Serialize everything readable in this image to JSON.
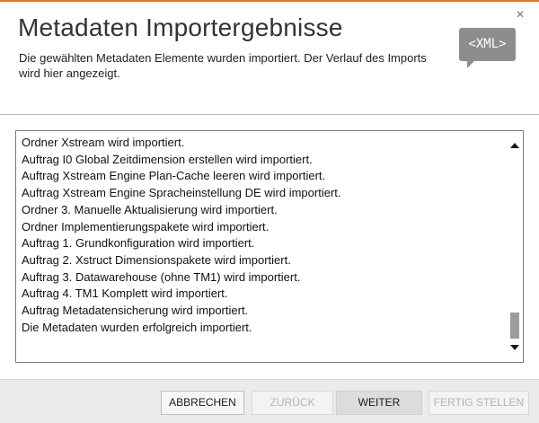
{
  "header": {
    "title": "Metadaten Importergebnisse",
    "description": "Die gewählten Metadaten Elemente wurden importiert. Der Verlauf des Imports wird hier angezeigt.",
    "icon_label": "<XML>"
  },
  "close": {
    "glyph": "×"
  },
  "log": {
    "lines": [
      "Ordner Xstream wird importiert.",
      "Auftrag I0 Global Zeitdimension erstellen wird importiert.",
      "Auftrag Xstream Engine Plan-Cache leeren wird importiert.",
      "Auftrag Xstream Engine Spracheinstellung DE wird importiert.",
      "Ordner 3. Manuelle Aktualisierung wird importiert.",
      "Ordner Implementierungspakete wird importiert.",
      "Auftrag 1. Grundkonfiguration wird importiert.",
      "Auftrag 2. Xstruct Dimensionspakete wird importiert.",
      "Auftrag 3. Datawarehouse (ohne TM1) wird importiert.",
      "Auftrag 4. TM1 Komplett wird importiert.",
      "Auftrag Metadatensicherung wird importiert.",
      "Die Metadaten wurden erfolgreich importiert."
    ]
  },
  "footer": {
    "cancel_label": "ABBRECHEN",
    "back_label": "ZURÜCK",
    "next_label": "WEITER",
    "finish_label": "FERTIG STELLEN"
  },
  "colors": {
    "accent": "#e87722",
    "icon_bg": "#8d8d8d",
    "footer_bg": "#ebebeb"
  }
}
